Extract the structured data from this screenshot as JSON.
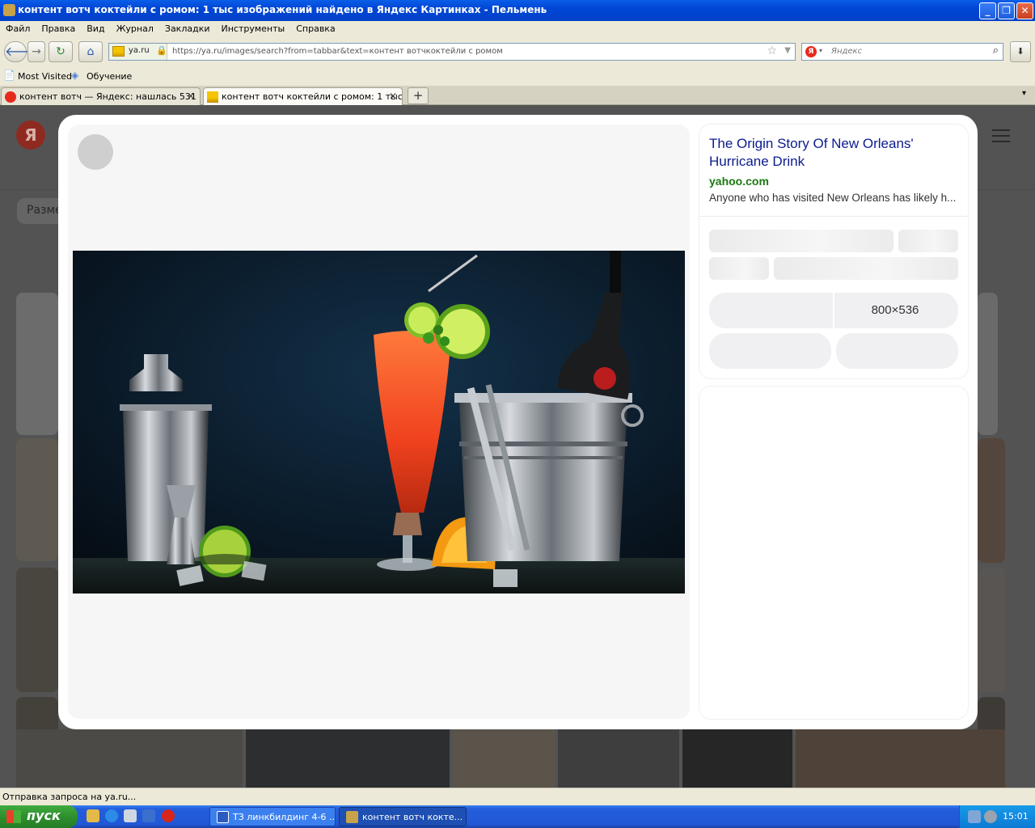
{
  "window": {
    "title": "контент вотч коктейли с ромом: 1 тыс изображений найдено в Яндекс Картинках - Пельмень"
  },
  "menu": [
    "Файл",
    "Правка",
    "Вид",
    "Журнал",
    "Закладки",
    "Инструменты",
    "Справка"
  ],
  "nav": {
    "site_label": "ya.ru",
    "url": "https://ya.ru/images/search?from=tabbar&text=контент вотчкоктейли с ромом",
    "search_placeholder": "Яндекс"
  },
  "bookmarks": [
    "Most Visited",
    "Обучение"
  ],
  "tabs": [
    {
      "label": "контент вотч — Яндекс: нашлась 531 ...",
      "active": false
    },
    {
      "label": "контент вотч коктейли с ромом: 1 тыс...",
      "active": true
    }
  ],
  "page": {
    "logo": "Я",
    "filter_label": "Разме"
  },
  "viewer": {
    "title": "The Origin Story Of New Orleans' Hurricane Drink",
    "site": "yahoo.com",
    "description": "Anyone who has visited New Orleans has likely h...",
    "dimensions": "800×536"
  },
  "status": {
    "text": "Отправка запроса на ya.ru..."
  },
  "taskbar": {
    "start_label": "пуск",
    "tasks": [
      "ТЗ линкбилдинг 4-6 ...",
      "контент вотч кокте..."
    ],
    "clock": "15:01"
  },
  "colors": {
    "title_link": "#0b1b8f",
    "site_green": "#1b7a10",
    "xp_blue": "#245edc",
    "start_green": "#2e8f2e"
  }
}
